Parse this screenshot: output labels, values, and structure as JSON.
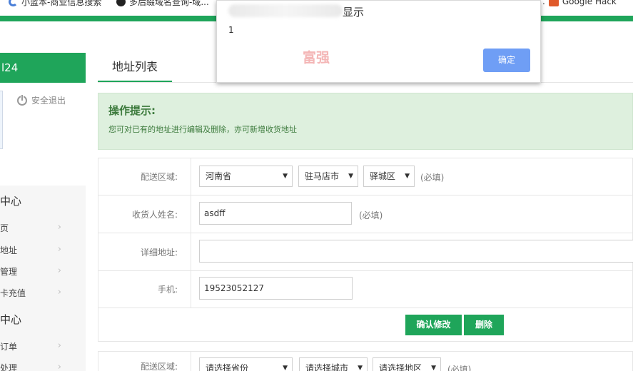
{
  "bookmarks": [
    {
      "label": "小蓝本-商业信息搜索",
      "icon": "g-logo-icon",
      "color": "#4a7fd8"
    },
    {
      "label": "多后缀域名查询-域...",
      "icon": "globe-icon",
      "color": "#222222"
    },
    {
      "label": "Google Hack",
      "icon": "c-logo-icon",
      "color": "#e05a2b"
    }
  ],
  "brand_color": "#1fa55a",
  "sidebar": {
    "user_label": "l24",
    "logout_label": "安全退出",
    "sections": [
      {
        "title": "中心",
        "items": [
          "页",
          "地址",
          "管理",
          "卡充值"
        ]
      },
      {
        "title": "中心",
        "items": [
          "订单",
          "处理"
        ]
      }
    ]
  },
  "main": {
    "tab_label": "地址列表",
    "tips": {
      "title": "操作提示:",
      "text": "您可对已有的地址进行编辑及删除，亦可新增收货地址"
    },
    "form": {
      "region_label": "配送区域:",
      "province": "河南省",
      "city": "驻马店市",
      "district": "驿城区",
      "required": "(必填)",
      "name_label": "收货人姓名:",
      "name_value": "asdff",
      "address_label": "详细地址:",
      "address_value": "",
      "phone_label": "手机:",
      "phone_value": "19523052127",
      "confirm_label": "确认修改",
      "delete_label": "删除"
    },
    "form2": {
      "region_label": "配送区域:",
      "province_placeholder": "请选择省份",
      "city_placeholder": "请选择城市",
      "district_placeholder": "请选择地区",
      "required": "(必填)"
    }
  },
  "dialog": {
    "title": "显示",
    "message": "1",
    "watermark": "富强",
    "ok_label": "确定",
    "ok_color": "#6f9ef5"
  }
}
